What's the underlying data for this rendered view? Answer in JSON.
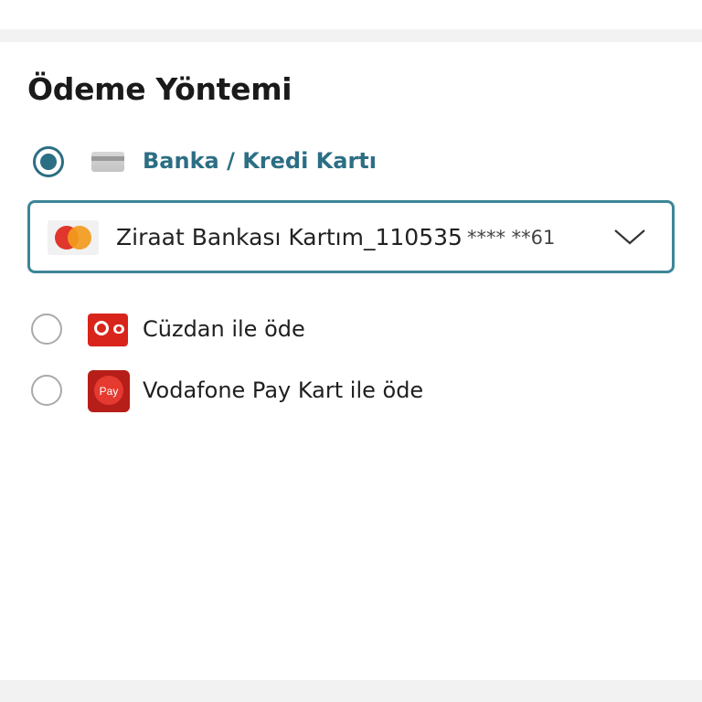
{
  "payment": {
    "title": "Ödeme Yöntemi",
    "options": [
      {
        "label": "Banka / Kredi Kartı",
        "selected": true,
        "icon": "credit-card-icon"
      },
      {
        "label": "Cüzdan ile öde",
        "selected": false,
        "icon": "vodafone-wallet-icon"
      },
      {
        "label": "Vodafone Pay Kart ile öde",
        "selected": false,
        "icon": "vodafone-pay-icon"
      }
    ],
    "selected_card": {
      "name": "Ziraat Bankası Kartım_110535",
      "masked_number": "**** **61",
      "brand_icon": "mastercard-icon"
    },
    "pay_icon_text": "Pay"
  },
  "colors": {
    "accent": "#2c6e84",
    "border": "#3d8598",
    "vodafone_red": "#d9241b"
  }
}
